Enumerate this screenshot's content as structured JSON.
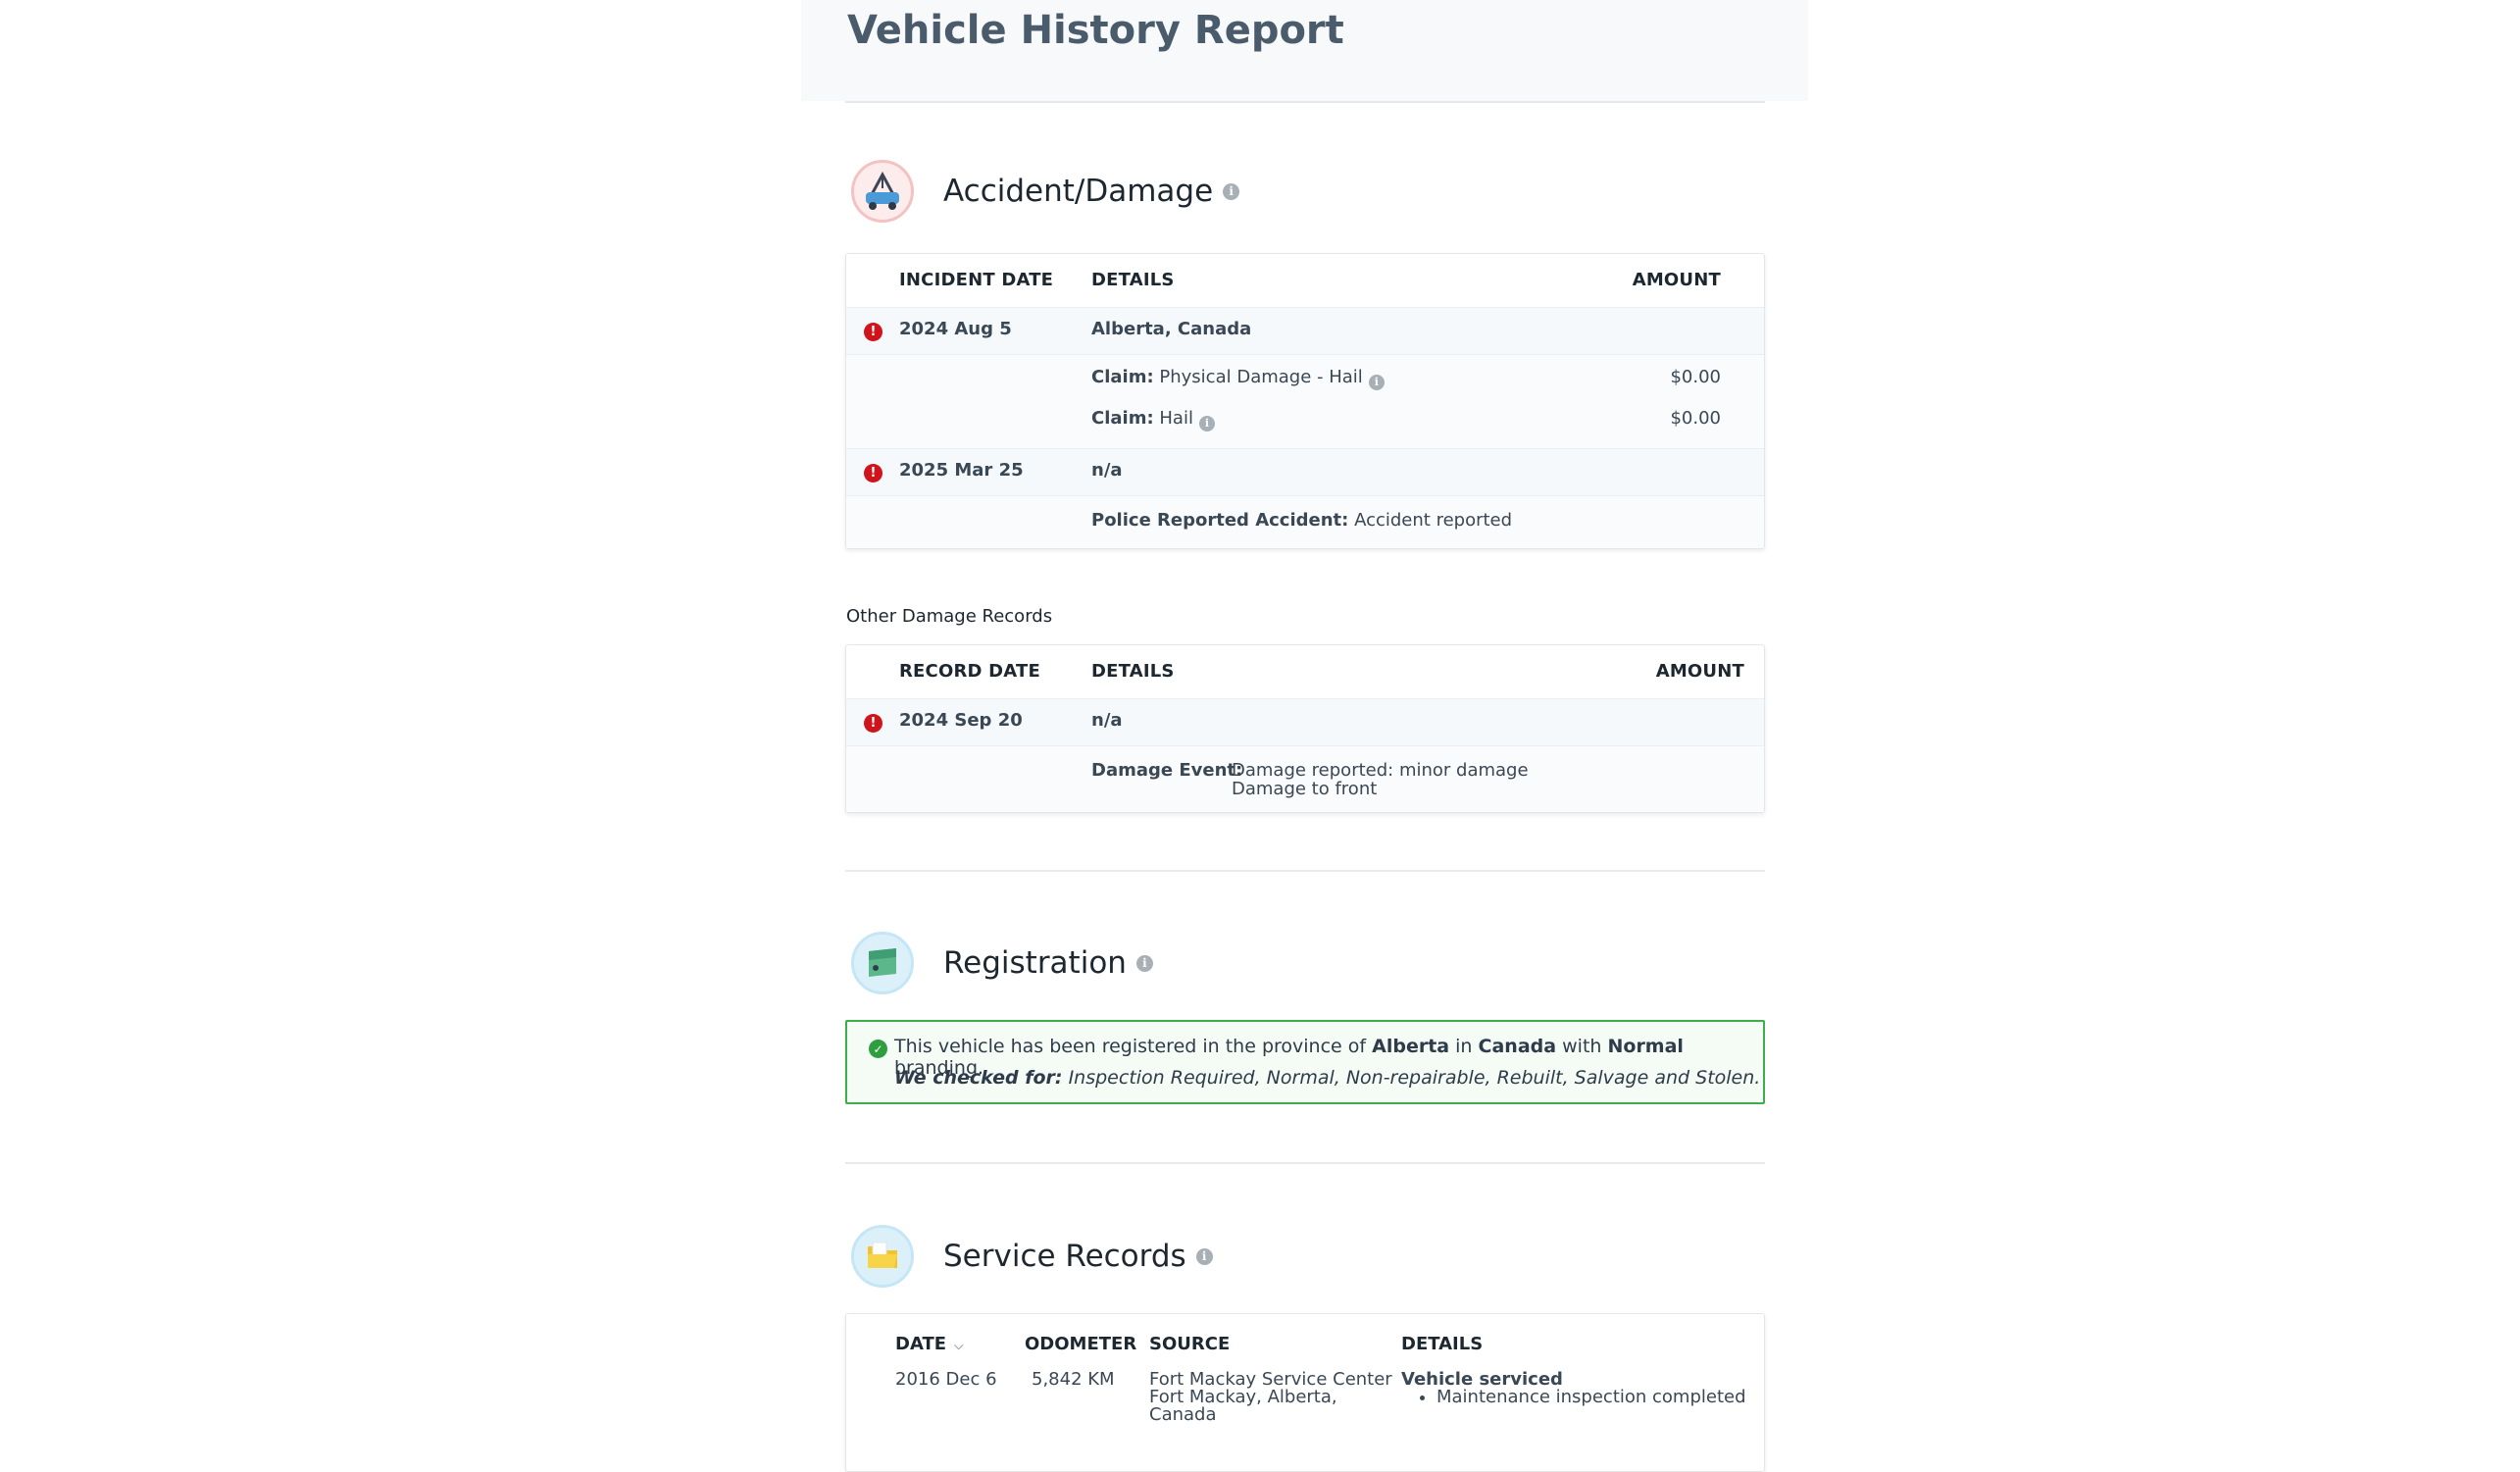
{
  "report": {
    "title": "Vehicle History Report"
  },
  "accident": {
    "title": "Accident/Damage",
    "columns": {
      "date": "INCIDENT DATE",
      "details": "DETAILS",
      "amount": "AMOUNT"
    },
    "incidents": [
      {
        "date": "2024 Aug 5",
        "location": "Alberta, Canada",
        "claims": [
          {
            "label": "Claim:",
            "value": "Physical Damage - Hail",
            "amount": "$0.00"
          },
          {
            "label": "Claim:",
            "value": "Hail",
            "amount": "$0.00"
          }
        ]
      },
      {
        "date": "2025 Mar 25",
        "location": "n/a",
        "detail_label": "Police Reported Accident:",
        "detail_value": "Accident reported"
      }
    ]
  },
  "other_damage": {
    "label": "Other Damage Records",
    "columns": {
      "date": "RECORD DATE",
      "details": "DETAILS",
      "amount": "AMOUNT"
    },
    "records": [
      {
        "date": "2024 Sep 20",
        "location": "n/a",
        "event_label": "Damage Event:",
        "event_line1": "Damage reported: minor damage",
        "event_line2": "Damage to front"
      }
    ]
  },
  "registration": {
    "title": "Registration",
    "text_prefix": "This vehicle has been registered in the province of",
    "province": "Alberta",
    "text_in": "in",
    "country": "Canada",
    "text_with": "with",
    "branding": "Normal",
    "text_suffix": "branding.",
    "checked_label": "We checked for:",
    "checked_list": "Inspection Required, Normal, Non-repairable, Rebuilt, Salvage and Stolen."
  },
  "service": {
    "title": "Service Records",
    "columns": {
      "date": "DATE",
      "odometer": "ODOMETER",
      "source": "SOURCE",
      "details": "DETAILS"
    },
    "records": [
      {
        "date": "2016 Dec 6",
        "odometer": "5,842 KM",
        "source_line1": "Fort Mackay Service Center",
        "source_line2": "Fort Mackay, Alberta,",
        "source_line3": "Canada",
        "details_title": "Vehicle serviced",
        "details_items": [
          "Maintenance inspection completed"
        ]
      }
    ]
  },
  "colors": {
    "error": "#d0141b",
    "success": "#3fae49",
    "title": "#4a5b6c"
  },
  "icons": {
    "accident": "tow-truck-icon",
    "registration": "registration-card-icon",
    "service": "folder-icon",
    "info": "info-icon"
  }
}
